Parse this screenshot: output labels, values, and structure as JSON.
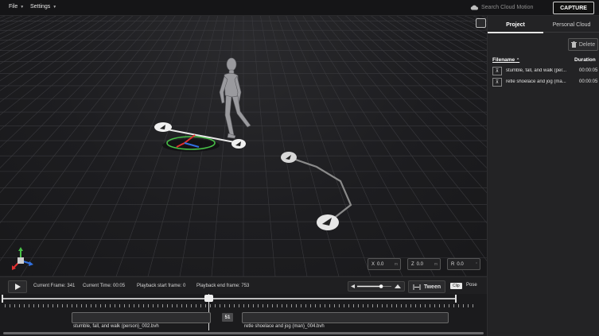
{
  "menu": {
    "file_label": "File",
    "settings_label": "Settings"
  },
  "search": {
    "placeholder": "Search Cloud Motion"
  },
  "capture_label": "CAPTURE",
  "panel": {
    "tabs": [
      {
        "label": "Project"
      },
      {
        "label": "Personal Cloud"
      }
    ],
    "delete_label": "Delete",
    "columns": {
      "filename": "Filename",
      "duration": "Duration"
    },
    "files": [
      {
        "name": "stumble, fall, and walk (per...",
        "duration": "00:00:05"
      },
      {
        "name": "retle shoelace and jog (ma...",
        "duration": "00:00:05"
      }
    ]
  },
  "coords": {
    "x": {
      "axis": "X",
      "value": "0.0",
      "unit": "m"
    },
    "z": {
      "axis": "Z",
      "value": "0.0",
      "unit": "m"
    },
    "r": {
      "axis": "R",
      "value": "0.0",
      "unit": "°"
    }
  },
  "controls": {
    "current_frame_label": "Current Frame:",
    "current_frame": "341",
    "current_time_label": "Current Time:",
    "current_time": "00:05",
    "playback_start_label": "Playback start frame:",
    "playback_start": "0",
    "playback_end_label": "Playback end frame:",
    "playback_end": "753",
    "tween_label": "Tween",
    "clip_label": "Clip",
    "pose_label": "Pose",
    "speed_level": 0.7
  },
  "timeline": {
    "clip1_label": "stumble, fall, and walk (person)_002.bvh",
    "clip2_label": "retle shoelace and jog (man)_004.bvh",
    "frame_badge": "51"
  },
  "colors": {
    "background": "#1b1b1d",
    "gizmo_x": "#e03030",
    "gizmo_y": "#40c040",
    "gizmo_z": "#3070e0"
  }
}
